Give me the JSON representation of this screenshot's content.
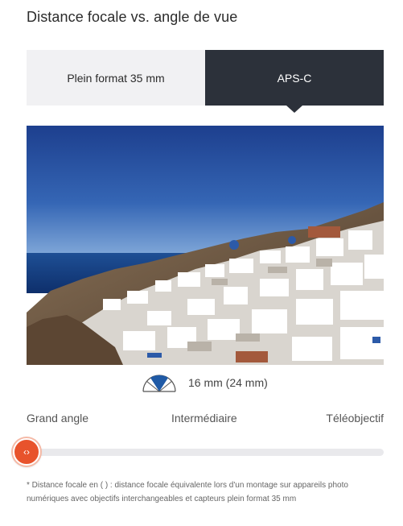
{
  "header": {
    "title": "Distance focale vs. angle de vue"
  },
  "tabs": [
    {
      "label": "Plein format 35 mm",
      "active": false
    },
    {
      "label": "APS-C",
      "active": true
    }
  ],
  "fov": {
    "label": "16 mm (24 mm)",
    "icon": "angle-of-view-icon"
  },
  "range": {
    "left_label": "Grand angle",
    "middle_label": "Intermédiaire",
    "right_label": "Téléobjectif"
  },
  "slider": {
    "value": 0,
    "handle_glyph": "‹›"
  },
  "footnote": "* Distance focale en ( ) : distance focale équivalente lors d'un montage sur appareils photo numériques avec objectifs interchangeables et capteurs plein format 35 mm",
  "colors": {
    "accent": "#e8532c",
    "dark_tab": "#2c313a",
    "light_tab": "#f1f1f3"
  }
}
